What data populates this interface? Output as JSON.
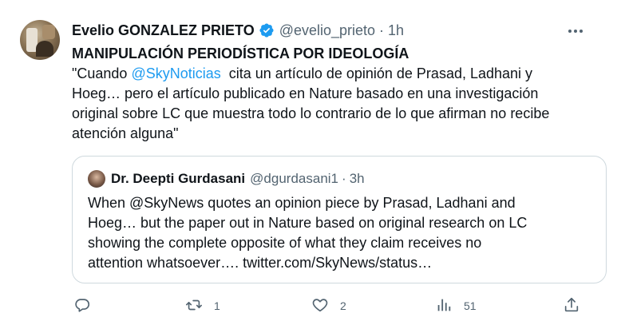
{
  "tweet": {
    "author_name": "Evelio GONZALEZ PRIETO",
    "author_handle": "@evelio_prieto",
    "separator": "·",
    "time": "1h",
    "headline": "MANIPULACIÓN PERIODÍSTICA POR IDEOLOGÍA",
    "line1_prefix": "\"Cuando ",
    "line1_mention": "@SkyNoticias",
    "line1_suffix": "  cita un artículo de opinión de Prasad, Ladhani y",
    "line2": "Hoeg… pero el artículo publicado en Nature basado en una investigación",
    "line3": "original sobre LC que muestra todo lo contrario de lo que afirman no recibe",
    "line4": "atención alguna\""
  },
  "quote": {
    "author_name": "Dr. Deepti Gurdasani",
    "author_handle": "@dgurdasani1",
    "separator": "·",
    "time": "3h",
    "line1": "When @SkyNews quotes an opinion piece by Prasad, Ladhani and",
    "line2": "Hoeg…  but the paper out in Nature based on original research on LC",
    "line3": "showing the complete opposite of what they claim receives no",
    "line4": "attention whatsoever…. twitter.com/SkyNews/status…"
  },
  "actions": {
    "reply_count": "",
    "retweet_count": "1",
    "like_count": "2",
    "views_count": "51"
  },
  "icons": {
    "verified": "verified-badge-icon",
    "more": "more-icon",
    "reply": "reply-icon",
    "retweet": "retweet-icon",
    "like": "heart-icon",
    "views": "views-icon",
    "share": "share-icon"
  },
  "colors": {
    "text": "#0f1419",
    "secondary": "#536471",
    "accent": "#1d9bf0",
    "border": "#cfd9de"
  }
}
